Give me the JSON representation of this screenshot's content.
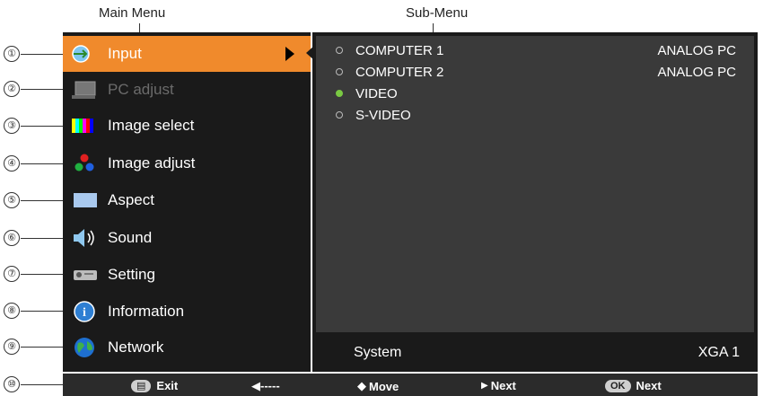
{
  "labels": {
    "main_menu": "Main Menu",
    "sub_menu": "Sub-Menu"
  },
  "callouts": [
    "①",
    "②",
    "③",
    "④",
    "⑤",
    "⑥",
    "⑦",
    "⑧",
    "⑨",
    "⑩"
  ],
  "main_menu": [
    {
      "label": "Input",
      "icon": "input-icon",
      "selected": true
    },
    {
      "label": "PC adjust",
      "icon": "pc-adjust-icon",
      "disabled": true
    },
    {
      "label": "Image select",
      "icon": "image-select-icon"
    },
    {
      "label": "Image adjust",
      "icon": "image-adjust-icon"
    },
    {
      "label": "Aspect",
      "icon": "aspect-icon"
    },
    {
      "label": "Sound",
      "icon": "sound-icon"
    },
    {
      "label": "Setting",
      "icon": "setting-icon"
    },
    {
      "label": "Information",
      "icon": "information-icon"
    },
    {
      "label": "Network",
      "icon": "network-icon"
    }
  ],
  "sub_menu": [
    {
      "name": "COMPUTER 1",
      "value": "ANALOG PC",
      "active": false
    },
    {
      "name": "COMPUTER 2",
      "value": "ANALOG PC",
      "active": false
    },
    {
      "name": "VIDEO",
      "value": "",
      "active": true
    },
    {
      "name": "S-VIDEO",
      "value": "",
      "active": false
    }
  ],
  "system": {
    "label": "System",
    "value": "XGA 1"
  },
  "bottom": {
    "exit_key": "▤",
    "exit": "Exit",
    "back": "◀-----",
    "move_icon": "◆",
    "move": "Move",
    "next_arrow": "▶",
    "next": "Next",
    "ok_key": "OK",
    "ok_next": "Next"
  },
  "colors": {
    "selected": "#f08a2c",
    "menu_bg": "#1a1a1a",
    "submenu_bg": "#3a3a3a",
    "active_bullet": "#7ac943"
  }
}
